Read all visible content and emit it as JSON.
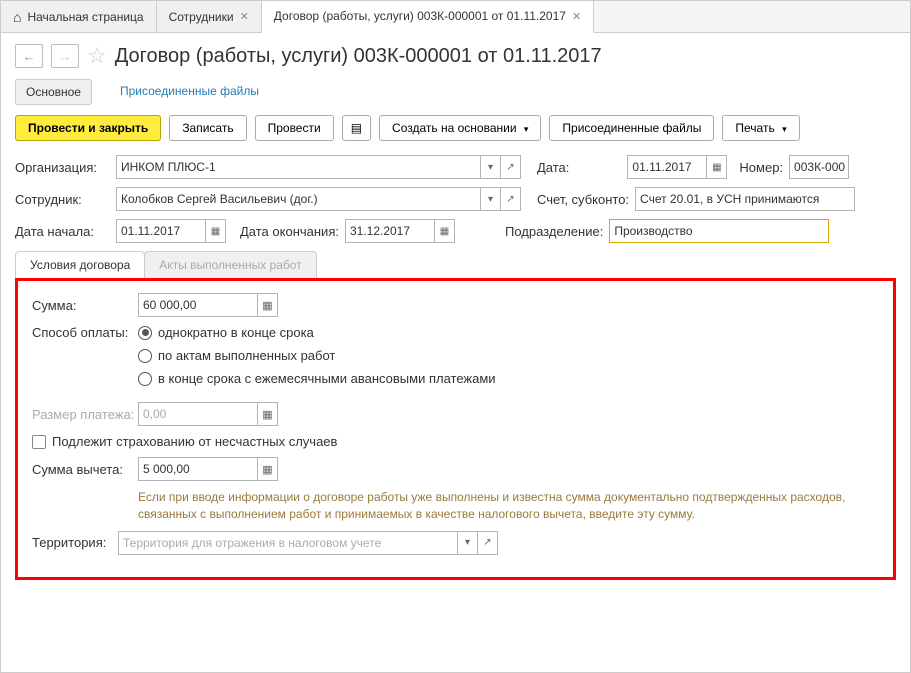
{
  "tabs": {
    "home": "Начальная страница",
    "employees": "Сотрудники",
    "contract": "Договор (работы, услуги) 003К-000001 от 01.11.2017"
  },
  "pageTitle": "Договор (работы, услуги) 003К-000001 от 01.11.2017",
  "subTabs": {
    "main": "Основное",
    "files": "Присоединенные файлы"
  },
  "toolbar": {
    "postClose": "Провести и закрыть",
    "save": "Записать",
    "post": "Провести",
    "createBased": "Создать на основании",
    "attachedFiles": "Присоединенные файлы",
    "print": "Печать"
  },
  "labels": {
    "org": "Организация:",
    "date": "Дата:",
    "number": "Номер:",
    "employee": "Сотрудник:",
    "account": "Счет, субконто:",
    "startDate": "Дата начала:",
    "endDate": "Дата окончания:",
    "department": "Подразделение:",
    "sum": "Сумма:",
    "payMethod": "Способ оплаты:",
    "paymentSize": "Размер платежа:",
    "insurance": "Подлежит страхованию от несчастных случаев",
    "deduction": "Сумма вычета:",
    "territory": "Территория:"
  },
  "fields": {
    "org": "ИНКОМ ПЛЮС-1",
    "date": "01.11.2017",
    "number": "003К-000",
    "employee": "Колобков Сергей Васильевич (дог.)",
    "account": "Счет 20.01, в УСН принимаются",
    "startDate": "01.11.2017",
    "endDate": "31.12.2017",
    "department": "Производство",
    "sum": "60 000,00",
    "paymentSize": "0,00",
    "deduction": "5 000,00",
    "territoryPlaceholder": "Территория для отражения в налоговом учете"
  },
  "innerTabs": {
    "terms": "Условия договора",
    "acts": "Акты выполненных работ"
  },
  "radios": {
    "once": "однократно в конце срока",
    "acts": "по актам выполненных работ",
    "monthly": "в конце срока с ежемесячными авансовыми платежами"
  },
  "hint": "Если при вводе информации о договоре работы уже выполнены и известна сумма документально подтвержденных расходов, связанных с выполнением работ и принимаемых в качестве налогового вычета, введите эту сумму."
}
